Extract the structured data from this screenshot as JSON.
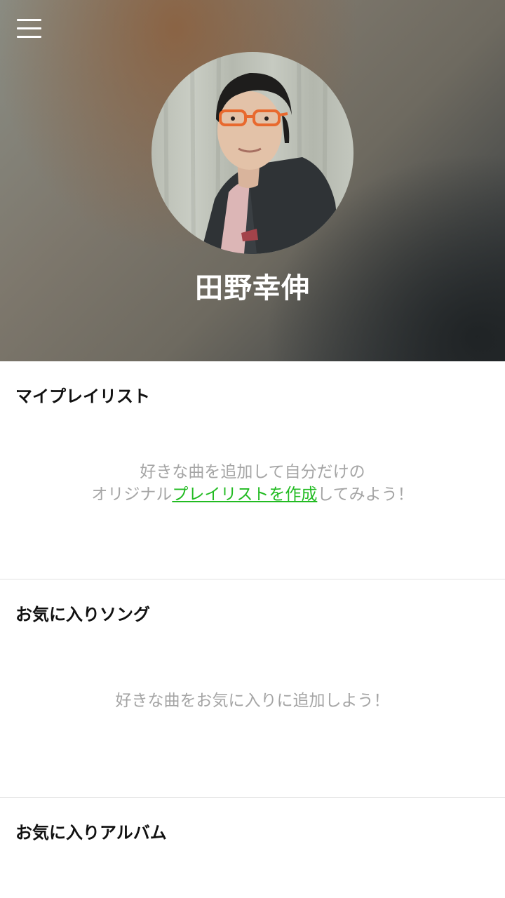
{
  "header": {
    "menu_icon": "hamburger-menu-icon",
    "profile_name": "田野幸伸"
  },
  "playlist_section": {
    "title": "マイプレイリスト",
    "empty_line1": "好きな曲を追加して自分だけの",
    "empty_line2_prefix": "オリジナル",
    "empty_link": "プレイリストを作成",
    "empty_line2_suffix": "してみよう！",
    "link_color": "#22bb22"
  },
  "favorite_songs_section": {
    "title": "お気に入りソング",
    "empty_message": "好きな曲をお気に入りに追加しよう！"
  },
  "favorite_albums_section": {
    "title": "お気に入りアルバム"
  }
}
